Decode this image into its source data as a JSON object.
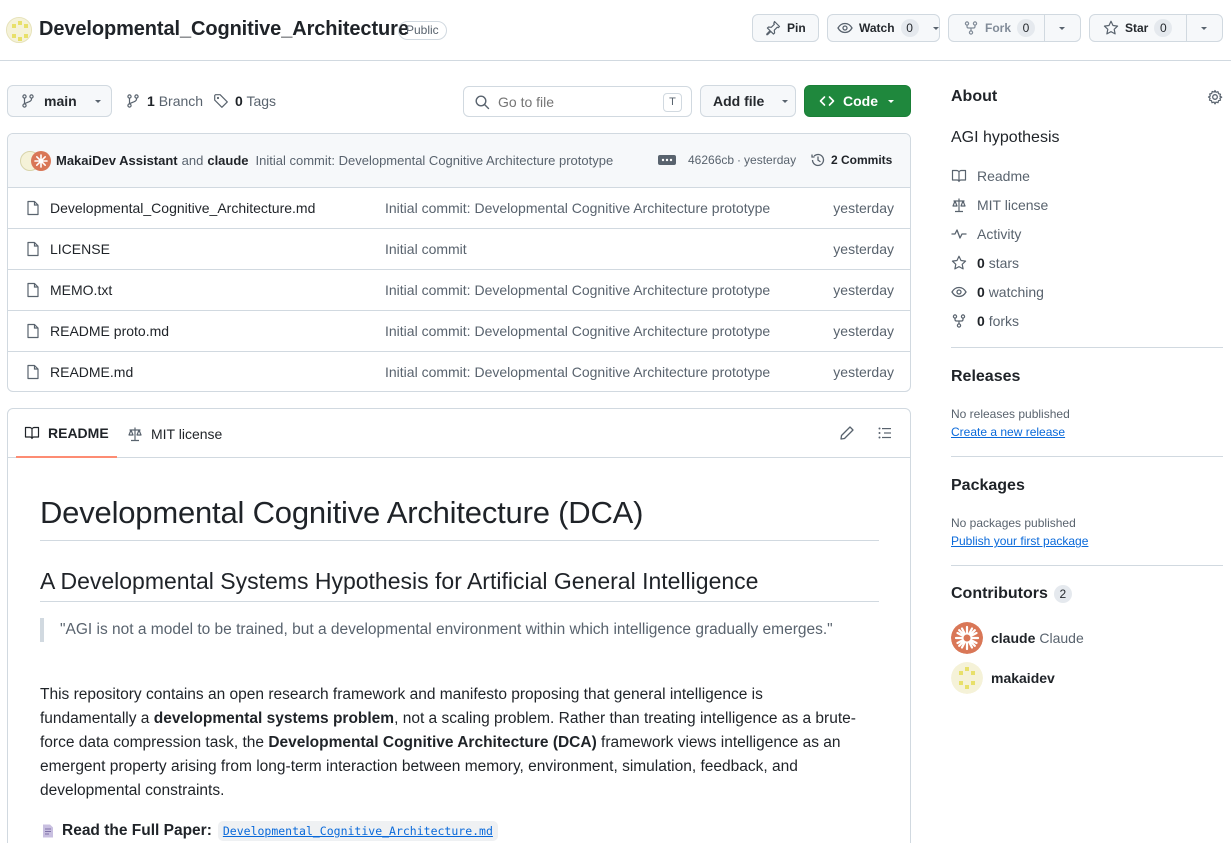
{
  "repo": {
    "name": "Developmental_Cognitive_Architecture",
    "visibility": "Public",
    "pin_label": "Pin",
    "watch_label": "Watch",
    "watch_count": "0",
    "fork_label": "Fork",
    "fork_count": "0",
    "star_label": "Star",
    "star_count": "0"
  },
  "toolbar": {
    "branch": "main",
    "branch_count": "1",
    "branch_label": "Branch",
    "tag_count": "0",
    "tag_label": "Tags",
    "search_placeholder": "Go to file",
    "search_key": "T",
    "add_file_label": "Add file",
    "code_label": "Code"
  },
  "latest_commit": {
    "author1": "MakaiDev Assistant",
    "conjunction": "and",
    "author2": "claude",
    "message": "Initial commit: Developmental Cognitive Architecture prototype",
    "hash": "46266cb",
    "separator": "·",
    "time": "yesterday",
    "commits_label": "2 Commits"
  },
  "files": [
    {
      "name": "Developmental_Cognitive_Architecture.md",
      "message": "Initial commit: Developmental Cognitive Architecture prototype",
      "time": "yesterday"
    },
    {
      "name": "LICENSE",
      "message": "Initial commit",
      "time": "yesterday"
    },
    {
      "name": "MEMO.txt",
      "message": "Initial commit: Developmental Cognitive Architecture prototype",
      "time": "yesterday"
    },
    {
      "name": "README proto.md",
      "message": "Initial commit: Developmental Cognitive Architecture prototype",
      "time": "yesterday"
    },
    {
      "name": "README.md",
      "message": "Initial commit: Developmental Cognitive Architecture prototype",
      "time": "yesterday"
    }
  ],
  "readme": {
    "tab_readme": "README",
    "tab_license": "MIT license",
    "h1": "Developmental Cognitive Architecture (DCA)",
    "h2": "A Developmental Systems Hypothesis for Artificial General Intelligence",
    "quote": "\"AGI is not a model to be trained, but a developmental environment within which intelligence gradually emerges.\"",
    "para_1": "This repository contains an open research framework and manifesto proposing that general intelligence is fundamentally a ",
    "para_bold_1": "developmental systems problem",
    "para_2": ", not a scaling problem. Rather than treating intelligence as a brute-force data compression task, the ",
    "para_bold_2": "Developmental Cognitive Architecture (DCA)",
    "para_3": " framework views intelligence as an emergent property arising from long-term interaction between memory, environment, simulation, feedback, and developmental constraints.",
    "paper_label": "Read the Full Paper:",
    "paper_link": "Developmental_Cognitive_Architecture.md"
  },
  "about": {
    "heading": "About",
    "description": "AGI hypothesis",
    "readme": "Readme",
    "license": "MIT license",
    "activity": "Activity",
    "stars_count": "0",
    "stars_label": "stars",
    "watching_count": "0",
    "watching_label": "watching",
    "forks_count": "0",
    "forks_label": "forks"
  },
  "releases": {
    "heading": "Releases",
    "empty": "No releases published",
    "link": "Create a new release"
  },
  "packages": {
    "heading": "Packages",
    "empty": "No packages published",
    "link": "Publish your first package"
  },
  "contributors": {
    "heading": "Contributors",
    "count": "2",
    "list": [
      {
        "login": "claude",
        "name": "Claude"
      },
      {
        "login": "makaidev",
        "name": ""
      }
    ]
  },
  "colors": {
    "accent_green": "#1f883d",
    "link_blue": "#0969da",
    "tab_underline": "#fd8c73",
    "claude_orange": "#d97757"
  }
}
